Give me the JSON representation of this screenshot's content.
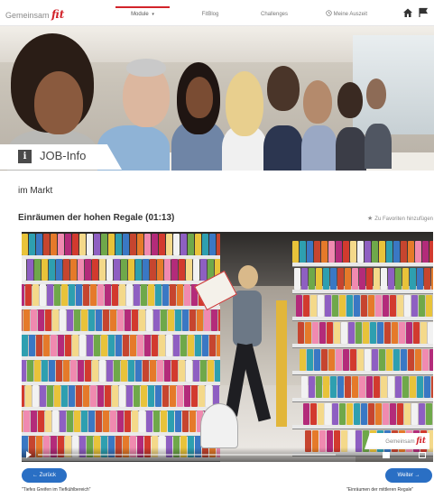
{
  "header": {
    "brand": {
      "prefix": "Gemeinsam",
      "accent": "fit"
    },
    "tabs": [
      {
        "label": "Module",
        "active": true
      },
      {
        "label": "FitBlog",
        "active": false
      },
      {
        "label": "Challenges",
        "active": false
      },
      {
        "label": "Meine Auszeit",
        "active": false
      }
    ],
    "icons": [
      "clock-icon",
      "home-icon",
      "flag-icon"
    ]
  },
  "hero": {
    "badge": "i",
    "title": "JOB-Info"
  },
  "section_title": "im Markt",
  "lesson": {
    "title": "Einräumen der hohen Regale (01:13)",
    "favorite_label": "Zu Favoriten hinzufügen"
  },
  "video": {
    "watermark": {
      "prefix": "Gemeinsam",
      "accent": "fit"
    },
    "progress": 0
  },
  "nav": {
    "back_label": "← Zurück",
    "back_caption": "\"Tiefes Greifen im Tiefkühlbereich\"",
    "next_label": "Weiter →",
    "next_caption": "\"Einräumen der mittleren Regale\""
  },
  "colors": {
    "accent": "#d2232a",
    "button": "#2a6fc4"
  }
}
